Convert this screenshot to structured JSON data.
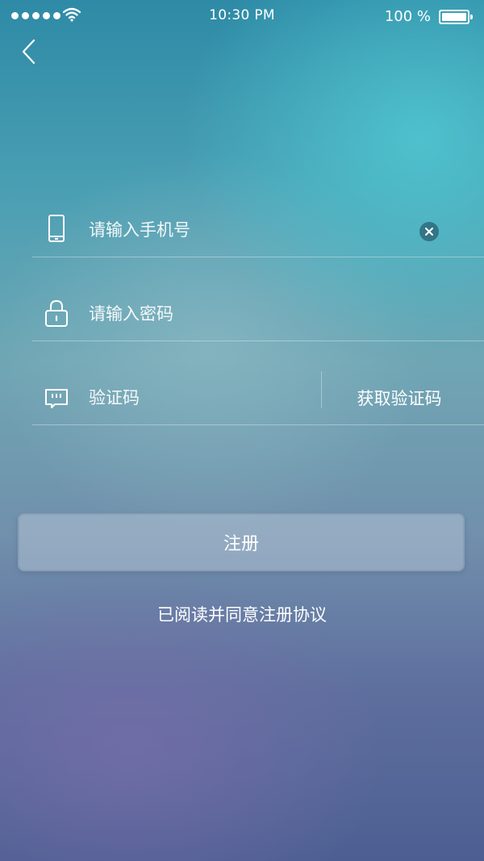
{
  "status_bar": {
    "time": "10:30 PM",
    "battery_percent": "100 %",
    "signal_icon": "signal-dots-icon",
    "wifi_icon": "wifi-icon",
    "battery_icon": "battery-full-icon"
  },
  "nav": {
    "back_icon": "chevron-left-icon"
  },
  "form": {
    "phone": {
      "icon": "mobile-phone-icon",
      "placeholder": "请输入手机号",
      "value": "",
      "clear_icon": "clear-x-icon"
    },
    "password": {
      "icon": "lock-icon",
      "placeholder": "请输入密码",
      "value": ""
    },
    "code": {
      "icon": "message-bubble-icon",
      "placeholder": "验证码",
      "value": "",
      "get_code_label": "获取验证码"
    }
  },
  "register_label": "注册",
  "agreement_text": "已阅读并同意注册协议"
}
